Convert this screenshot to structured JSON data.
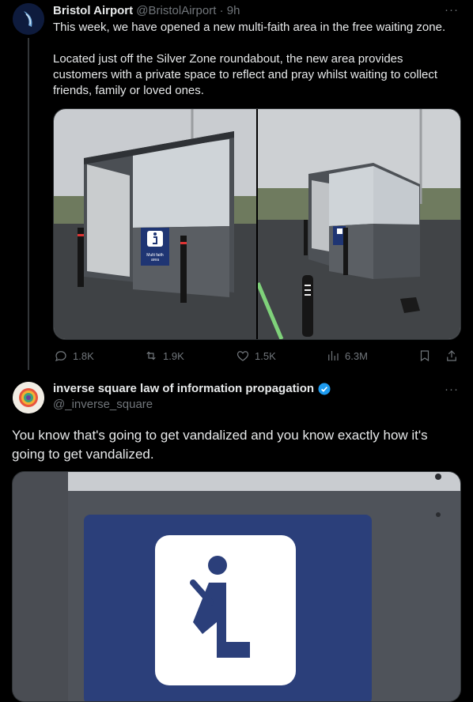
{
  "tweet1": {
    "display_name": "Bristol Airport",
    "handle": "@BristolAirport",
    "time": "· 9h",
    "text_p1": "This week, we have opened a new multi-faith area in the free waiting zone.",
    "text_p2": "Located just off the Silver Zone roundabout, the new area provides customers with a private space to reflect and pray whilst waiting to collect friends, family or loved ones.",
    "sign_text": "Multi faith area",
    "replies": "1.8K",
    "reposts": "1.9K",
    "likes": "1.5K",
    "views": "6.3M"
  },
  "tweet2": {
    "display_name": "inverse square law of information propagation",
    "handle": "@_inverse_square",
    "text": "You know that's going to get vandalized and you know exactly how it's going to get vandalized."
  },
  "more_label": "···",
  "colors": {
    "bg": "#000000",
    "text": "#e7e9ea",
    "muted": "#71767b",
    "verified": "#1d9bf0",
    "sign_blue": "#2b3f7a"
  }
}
